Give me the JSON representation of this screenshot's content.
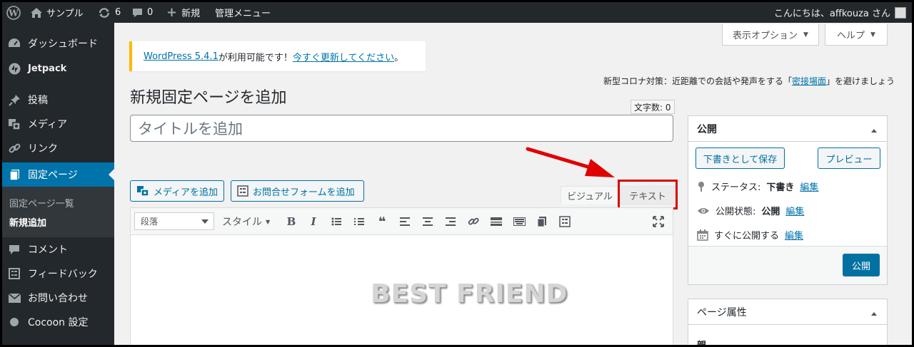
{
  "admin_bar": {
    "site_name": "サンプル",
    "updates_count": "6",
    "comments_count": "0",
    "new_label": "新規",
    "admin_menu_label": "管理メニュー",
    "greeting": "こんにちは、affkouza さん"
  },
  "sidebar": {
    "items": [
      {
        "label": "ダッシュボード",
        "icon": "dashboard-icon"
      },
      {
        "label": "Jetpack",
        "icon": "jetpack-icon"
      },
      {
        "label": "投稿",
        "icon": "pin-icon"
      },
      {
        "label": "メディア",
        "icon": "media-icon"
      },
      {
        "label": "リンク",
        "icon": "link-icon"
      },
      {
        "label": "固定ページ",
        "icon": "page-icon"
      },
      {
        "label": "コメント",
        "icon": "comment-icon"
      },
      {
        "label": "フィードバック",
        "icon": "feedback-icon"
      },
      {
        "label": "お問い合わせ",
        "icon": "mail-icon"
      },
      {
        "label": "Cocoon 設定",
        "icon": "circle-icon"
      }
    ],
    "submenu": [
      {
        "label": "固定ページ一覧"
      },
      {
        "label": "新規追加"
      }
    ]
  },
  "screen_options": {
    "label": "表示オプション"
  },
  "help": {
    "label": "ヘルプ"
  },
  "notice": {
    "link1": "WordPress 5.4.1",
    "text": " が利用可能です！",
    "link2": "今すぐ更新してください",
    "end": "。"
  },
  "corona": {
    "prefix": "新型コロナ対策：近距離での会話や発声をする「",
    "link": "密接場面",
    "suffix": "」を避けましょう"
  },
  "page_title": "新規固定ページを追加",
  "word_count": "文字数: 0",
  "title_placeholder": "タイトルを追加",
  "editor": {
    "add_media": "メディアを追加",
    "add_form": "お問合せフォームを追加",
    "tab_visual": "ビジュアル",
    "tab_text": "テキスト",
    "format_select": "段落",
    "style_label": "スタイル",
    "watermark": "BEST FRIEND"
  },
  "publish_box": {
    "title": "公開",
    "save_draft": "下書きとして保存",
    "preview": "プレビュー",
    "status_label": "ステータス:",
    "status_value": "下書き",
    "visibility_label": "公開状態:",
    "visibility_value": "公開",
    "schedule_label": "すぐに公開する",
    "edit": "編集",
    "publish_button": "公開"
  },
  "page_attributes": {
    "title": "ページ属性",
    "parent": "親"
  },
  "colors": {
    "admin_bg": "#23282d",
    "accent": "#0073aa",
    "notice_warning": "#ffb900",
    "highlight": "#d90000"
  }
}
